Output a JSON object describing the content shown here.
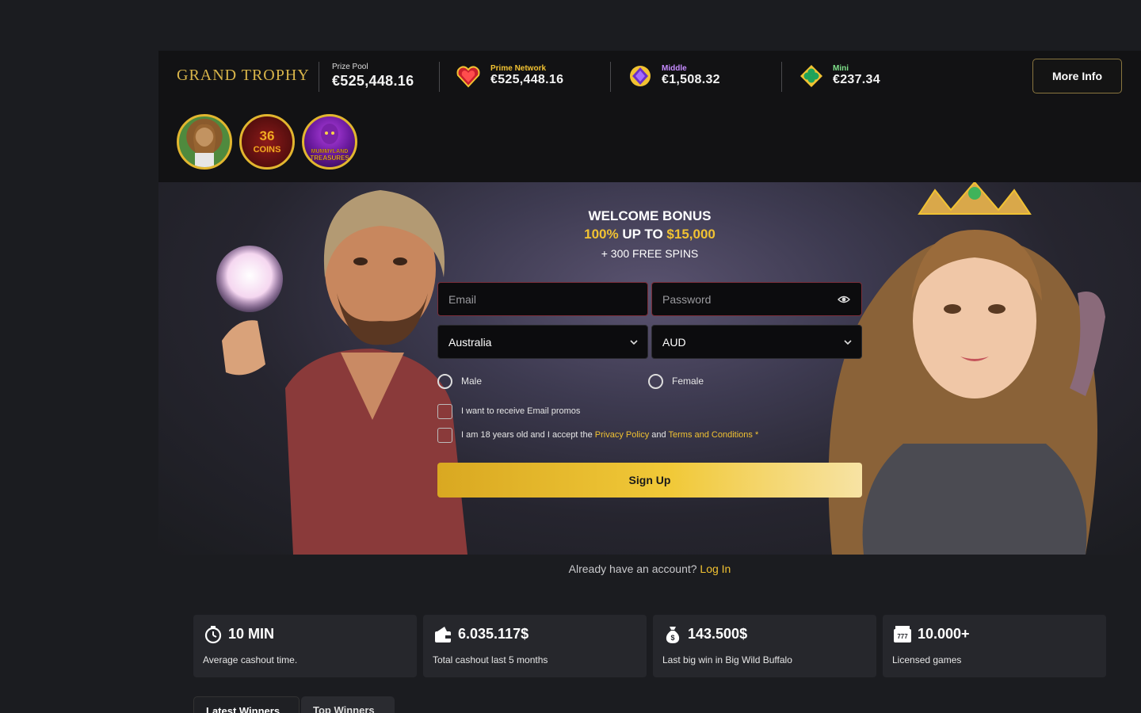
{
  "jackpot": {
    "brand": "GRAND TROPHY",
    "prize_pool_label": "Prize Pool",
    "prize_pool_value": "€525,448.16",
    "tiers": [
      {
        "label": "Prime Network",
        "value": "€525,448.16",
        "color": "#f1c232",
        "icon": "heart-gem-icon"
      },
      {
        "label": "Middle",
        "value": "€1,508.32",
        "color": "#c68bff",
        "icon": "diamond-gem-icon"
      },
      {
        "label": "Mini",
        "value": "€237.34",
        "color": "#7fe08a",
        "icon": "clover-gem-icon"
      }
    ],
    "more_info": "More Info",
    "games": [
      "game-thumb-lady",
      "game-thumb-36-coins",
      "game-thumb-mummyland-treasures"
    ]
  },
  "hero": {
    "title_line1": "WELCOME BONUS",
    "title_pct": "100%",
    "title_upto": " UP TO ",
    "title_amount": "$15,000",
    "title_line3": "+ 300 FREE SPINS"
  },
  "form": {
    "email_placeholder": "Email",
    "password_placeholder": "Password",
    "country": "Australia",
    "currency": "AUD",
    "gender_male": "Male",
    "gender_female": "Female",
    "promo_label": "I want to receive Email promos",
    "terms_prefix": "I am 18 years old and I accept the ",
    "terms_privacy": "Privacy Policy",
    "terms_and": " and ",
    "terms_conditions": "Terms and Conditions",
    "terms_required": " *",
    "signup": "Sign Up"
  },
  "login_prompt": {
    "text": "Already have an account? ",
    "link": "Log In"
  },
  "stats": [
    {
      "value": "10 MIN",
      "label": "Average cashout time.",
      "icon": "stopwatch-icon"
    },
    {
      "value": "6.035.117$",
      "label": "Total cashout last 5 months",
      "icon": "wallet-icon"
    },
    {
      "value": "143.500$",
      "label": "Last big win in Big Wild Buffalo",
      "icon": "money-bag-icon"
    },
    {
      "value": "10.000+",
      "label": "Licensed games",
      "icon": "slot-machine-icon"
    }
  ],
  "tabs": [
    {
      "label": "Latest Winners",
      "active": true
    },
    {
      "label": "Top Winners",
      "active": false
    }
  ]
}
